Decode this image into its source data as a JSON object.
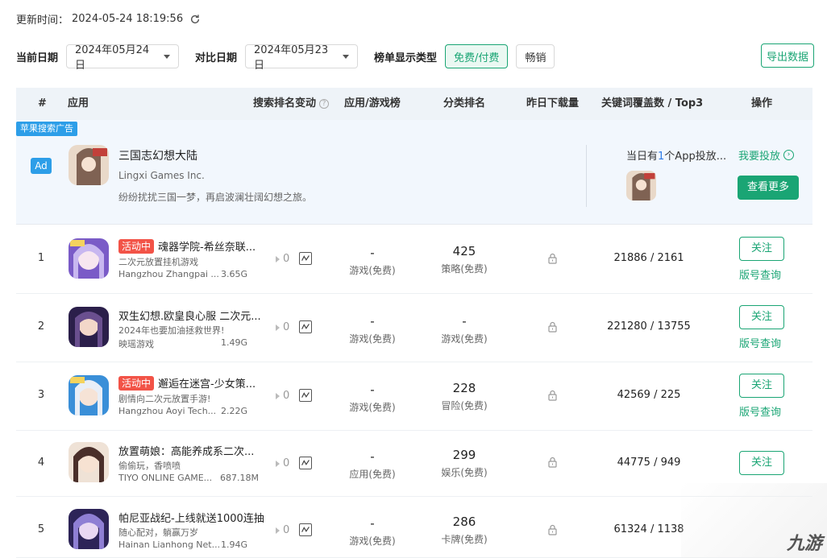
{
  "update": {
    "label": "更新时间：",
    "time": "2024-05-24 18:19:56"
  },
  "filters": {
    "current_label": "当前日期",
    "current_value": "2024年05月24日",
    "compare_label": "对比日期",
    "compare_value": "2024年05月23日",
    "type_label": "榜单显示类型",
    "type_options": [
      "免费/付费",
      "畅销"
    ],
    "export": "导出数据"
  },
  "table": {
    "headers": [
      "#",
      "应用",
      "搜索排名变动",
      "应用/游戏榜",
      "分类排名",
      "昨日下载量",
      "关键词覆盖数 / Top3",
      "操作"
    ]
  },
  "ad": {
    "tag": "苹果搜索广告",
    "badge": "Ad",
    "name": "三国志幻想大陆",
    "developer": "Lingxi Games Inc.",
    "desc": "纷纷扰扰三国一梦，再启波澜壮阔幻想之旅。",
    "info_prefix": "当日有",
    "info_num": "1",
    "info_suffix": "个App投放...",
    "link": "我要投放",
    "more": "查看更多"
  },
  "rows": [
    {
      "rank": "1",
      "hot": "活动中",
      "name": "魂器学院-希丝奈联...",
      "sub": "二次元放置挂机游戏",
      "dev": "Hangzhou Zhangpai ...",
      "size": "3.65G",
      "chg": "0",
      "appgame": "-",
      "appgame_sub": "游戏(免费)",
      "cat": "425",
      "cat_sub": "策略(免费)",
      "kw": "21886 / 2161",
      "follow": "关注",
      "link": "版号查询"
    },
    {
      "rank": "2",
      "hot": "",
      "name": "双生幻想.欧皇良心服 二次元...",
      "sub": "2024年也要加油拯救世界!",
      "dev": "映瑶游戏",
      "size": "1.49G",
      "chg": "0",
      "appgame": "-",
      "appgame_sub": "游戏(免费)",
      "cat": "-",
      "cat_sub": "游戏(免费)",
      "kw": "221280 / 13755",
      "follow": "关注",
      "link": "版号查询"
    },
    {
      "rank": "3",
      "hot": "活动中",
      "name": "邂逅在迷宫-少女策...",
      "sub": "剧情向二次元放置手游!",
      "dev": "Hangzhou Aoyi Tech...",
      "size": "2.22G",
      "chg": "0",
      "appgame": "-",
      "appgame_sub": "游戏(免费)",
      "cat": "228",
      "cat_sub": "冒险(免费)",
      "kw": "42569 / 225",
      "follow": "关注",
      "link": "版号查询"
    },
    {
      "rank": "4",
      "hot": "",
      "name": "放置萌娘：高能养成系二次...",
      "sub": "偷偷玩，香喷喷",
      "dev": "TIYO ONLINE GAME...",
      "size": "687.18M",
      "chg": "0",
      "appgame": "-",
      "appgame_sub": "应用(免费)",
      "cat": "299",
      "cat_sub": "娱乐(免费)",
      "kw": "44775 / 949",
      "follow": "关注",
      "link": ""
    },
    {
      "rank": "5",
      "hot": "",
      "name": "帕尼亚战纪-上线就送1000连抽",
      "sub": "随心配对，躺赢万岁",
      "dev": "Hainan Lianhong Net...",
      "size": "1.94G",
      "chg": "0",
      "appgame": "-",
      "appgame_sub": "游戏(免费)",
      "cat": "286",
      "cat_sub": "卡牌(免费)",
      "kw": "61324 / 1138",
      "follow": "",
      "link": ""
    }
  ],
  "watermark": "九游",
  "colors": {
    "accent": "#1aa574",
    "ad_blue": "#2d9ee8",
    "hot_red": "#f25347",
    "header_bg": "#eef3f8"
  }
}
